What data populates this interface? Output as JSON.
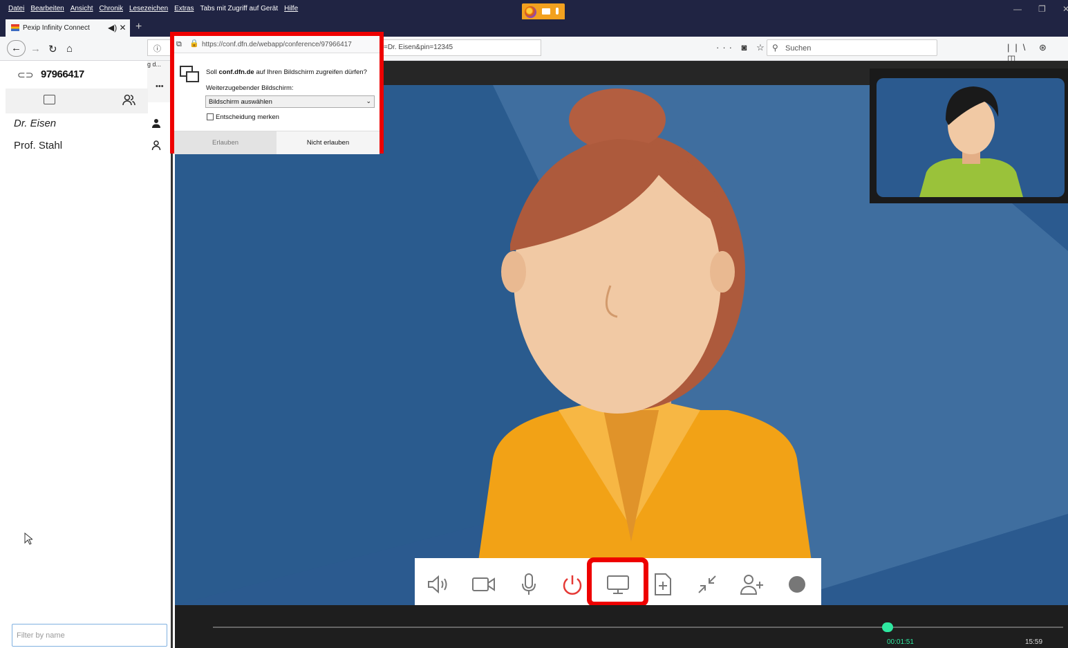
{
  "menubar": {
    "items": [
      "Datei",
      "Bearbeiten",
      "Ansicht",
      "Chronik",
      "Lesezeichen",
      "Extras",
      "Tabs mit Zugriff auf Gerät",
      "Hilfe"
    ]
  },
  "tab": {
    "title": "Pexip Infinity Connect",
    "controls": "◀) ✕",
    "new_tab": "+"
  },
  "nav": {
    "url_shown": "https://conf.dfn.de/webapp/conference/97966417",
    "url_tail": "=Dr. Eisen&pin=12345",
    "search_placeholder": "Suchen",
    "page_actions": "··· ◙ ☆",
    "tool_icons": "||\\ ⊛ ◫"
  },
  "sidebar": {
    "conference_id": "97966417",
    "menu_text": "g d...",
    "more": "•••",
    "participants": [
      {
        "name": "Dr. Eisen"
      },
      {
        "name": "Prof. Stahl"
      }
    ],
    "filter_placeholder": "Filter by name"
  },
  "permission": {
    "question_pre": "Soll ",
    "question_domain": "conf.dfn.de",
    "question_post": " auf Ihren Bildschirm zugreifen dürfen?",
    "screen_label": "Weiterzugebender Bildschirm:",
    "select_value": "Bildschirm auswählen",
    "remember_label": "Entscheidung merken",
    "allow": "Erlauben",
    "deny": "Nicht erlauben"
  },
  "video": {
    "time_current": "00:01:51",
    "time_end": "15:59"
  },
  "colors": {
    "accent": "#e00000",
    "progress": "#2ee8a0",
    "video_bg": "#2b5a8f"
  }
}
